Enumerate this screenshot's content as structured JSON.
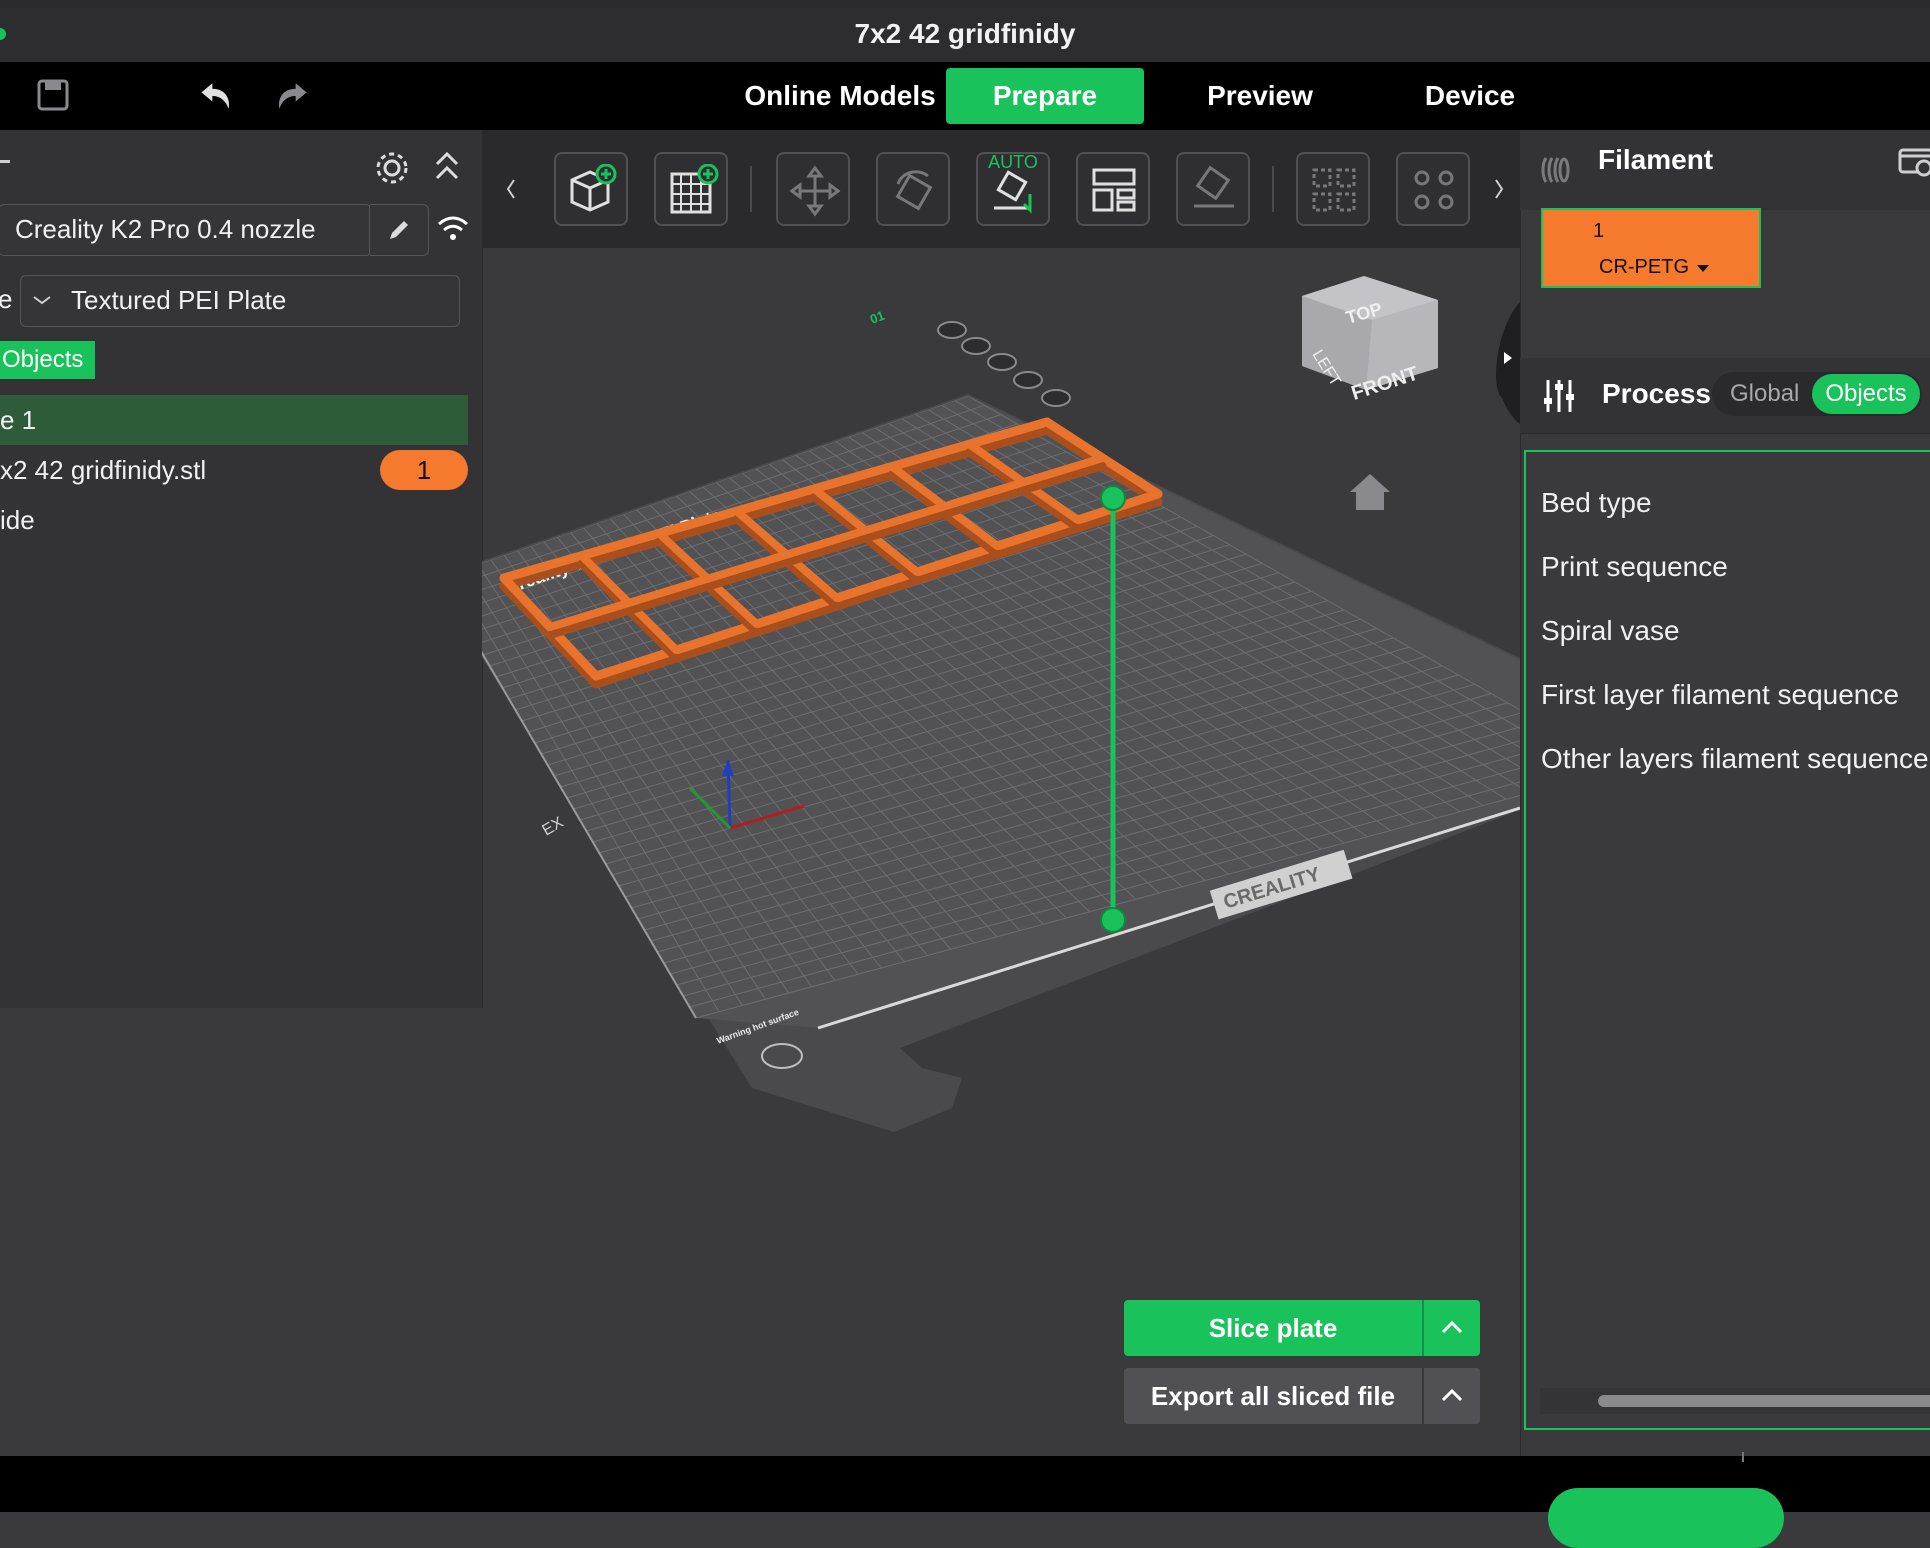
{
  "window": {
    "title": "7x2 42 gridfinidy"
  },
  "main_tabs": [
    {
      "label": "Online Models"
    },
    {
      "label": "Prepare"
    },
    {
      "label": "Preview"
    },
    {
      "label": "Device"
    }
  ],
  "printer": {
    "name": "Creality K2 Pro 0.4 nozzle"
  },
  "plate_type": {
    "prefix": "e",
    "value": "Textured PEI Plate"
  },
  "objects_tab": "Objects",
  "object_list": {
    "plate_row": "e 1",
    "model_name": "x2 42 gridfinidy.stl",
    "model_count": "1",
    "third_row": "ide"
  },
  "tool_auto_label": "AUTO",
  "viewport": {
    "bed_title": "Creality Textured PEI Plate",
    "bed_brand": "CREALITY",
    "plate_number": "01",
    "warning": "Warning hot surface",
    "view_cube": {
      "top": "TOP",
      "left": "LEFT",
      "front": "FRONT"
    }
  },
  "filament": {
    "header": "Filament",
    "slot_number": "1",
    "material": "CR-PETG"
  },
  "process": {
    "header": "Process",
    "global_label": "Global",
    "objects_label": "Objects",
    "settings": [
      "Bed type",
      "Print sequence",
      "Spiral vase",
      "First layer filament sequence",
      "Other layers filament sequence"
    ]
  },
  "actions": {
    "slice": "Slice plate",
    "export": "Export all sliced file"
  },
  "colors": {
    "accent_green": "#19c25a",
    "filament_orange": "#f57a2e",
    "model_orange": "#e8732c"
  }
}
